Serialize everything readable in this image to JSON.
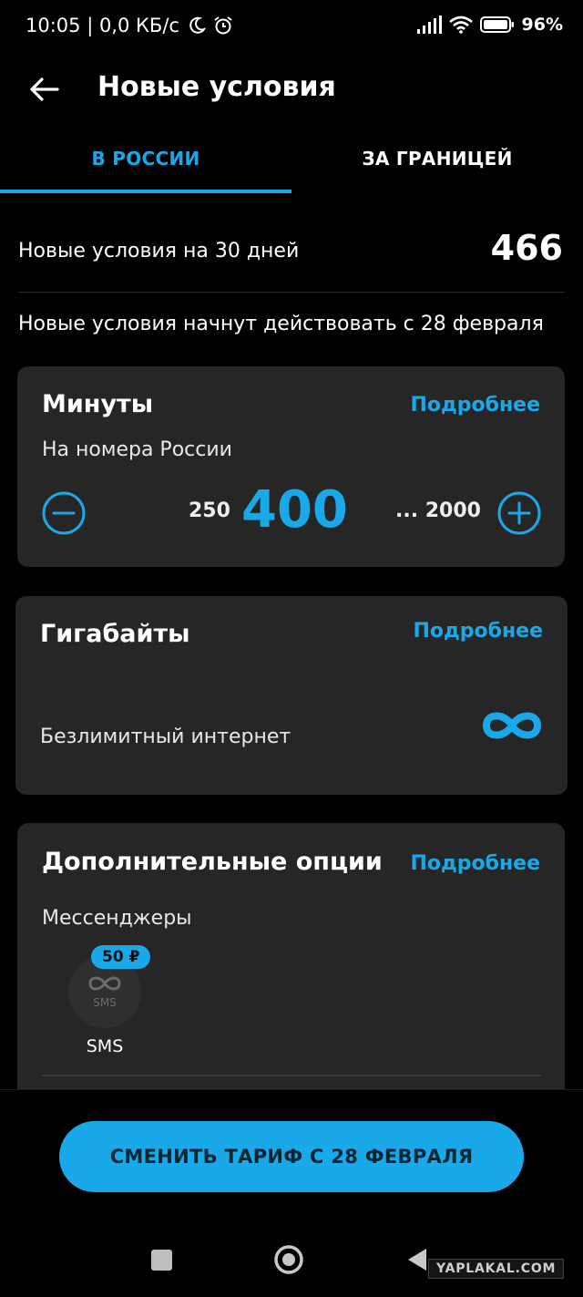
{
  "status": {
    "time_speed": "10:05 | 0,0 КБ/с",
    "battery": "96%"
  },
  "header": {
    "title": "Новые условия"
  },
  "tabs": [
    {
      "label": "В РОССИИ",
      "active": true
    },
    {
      "label": "ЗА ГРАНИЦЕЙ",
      "active": false
    }
  ],
  "summary": {
    "period_label": "Новые условия на 30 дней",
    "price": "466",
    "start_note": "Новые условия начнут действовать с 28 февраля"
  },
  "minutes_card": {
    "title": "Минуты",
    "more": "Подробнее",
    "subtitle": "На номера России",
    "min": "250",
    "value": "400",
    "max": "... 2000"
  },
  "gb_card": {
    "title": "Гигабайты",
    "more": "Подробнее",
    "subtitle": "Безлимитный интернет"
  },
  "options_card": {
    "title": "Дополнительные опции",
    "more": "Подробнее",
    "subtitle": "Мессенджеры",
    "sms_icon_text": "SMS",
    "sms_badge": "50 ₽",
    "sms_label": "SMS"
  },
  "cta": {
    "label": "СМЕНИТЬ ТАРИФ С 28 ФЕВРАЛЯ"
  },
  "watermark": "YAPLAKAL.COM",
  "colors": {
    "accent": "#1aa9e8",
    "card": "#262626",
    "background": "#000000"
  },
  "icons": [
    "moon-icon",
    "alarm-icon",
    "signal-icon",
    "wifi-icon",
    "battery-icon",
    "back-arrow-icon",
    "minus-icon",
    "plus-icon",
    "infinity-icon"
  ]
}
